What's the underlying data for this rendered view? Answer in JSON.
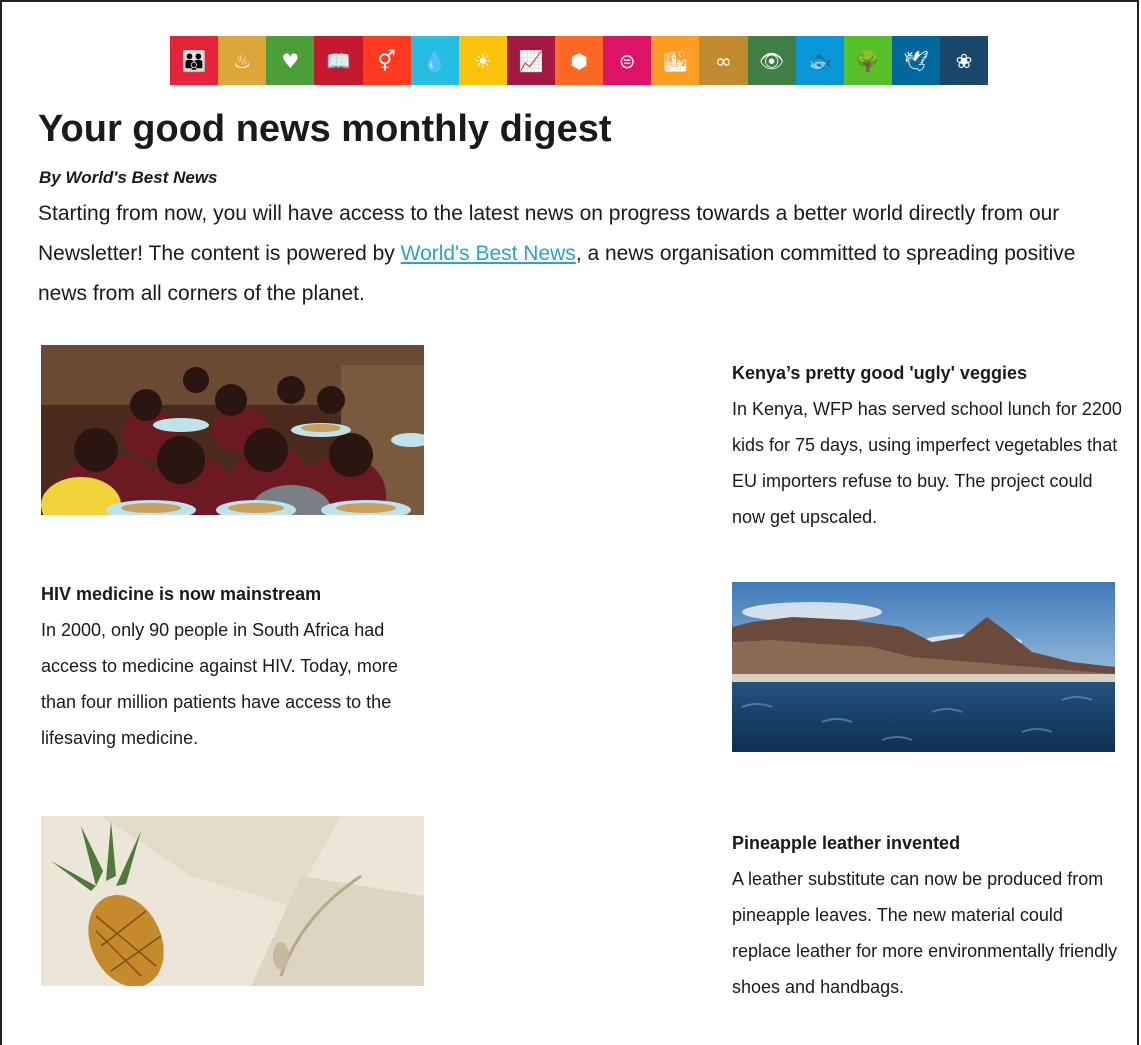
{
  "sdg_icons": [
    {
      "icon": "people-icon",
      "glyph": "👪",
      "color": "#e5243b"
    },
    {
      "icon": "bowl-icon",
      "glyph": "♨",
      "color": "#dda63a"
    },
    {
      "icon": "heartbeat-icon",
      "glyph": "♥",
      "color": "#4c9f38"
    },
    {
      "icon": "book-icon",
      "glyph": "📖",
      "color": "#c5192d"
    },
    {
      "icon": "gender-icon",
      "glyph": "⚥",
      "color": "#ff3a21"
    },
    {
      "icon": "water-drop-icon",
      "glyph": "💧",
      "color": "#26bde2"
    },
    {
      "icon": "sun-icon",
      "glyph": "☀",
      "color": "#fcc30b"
    },
    {
      "icon": "growth-chart-icon",
      "glyph": "📈",
      "color": "#a21942"
    },
    {
      "icon": "cubes-icon",
      "glyph": "⬢",
      "color": "#fd6925"
    },
    {
      "icon": "equality-icon",
      "glyph": "⊜",
      "color": "#dd1367"
    },
    {
      "icon": "city-icon",
      "glyph": "🏙",
      "color": "#fd9d24"
    },
    {
      "icon": "infinity-icon",
      "glyph": "∞",
      "color": "#bf8b2e"
    },
    {
      "icon": "eye-globe-icon",
      "glyph": "👁",
      "color": "#3f7e44"
    },
    {
      "icon": "fish-waves-icon",
      "glyph": "🐟",
      "color": "#0a97d9"
    },
    {
      "icon": "tree-icon",
      "glyph": "🌳",
      "color": "#56c02b"
    },
    {
      "icon": "dove-gavel-icon",
      "glyph": "🕊",
      "color": "#00689d"
    },
    {
      "icon": "flower-icon",
      "glyph": "❀",
      "color": "#19486a"
    }
  ],
  "header": {
    "title": "Your good news monthly digest",
    "byline": "By World's Best News"
  },
  "intro": {
    "before_link": "Starting from now, you will have access to the latest news on progress towards a better world directly from our Newsletter! The content is powered by ",
    "link_text": "World's Best News",
    "after_link": ", a news organisation committed to spreading positive news from all corners of the planet."
  },
  "articles": [
    {
      "title": "Kenya’s pretty good 'ugly' veggies",
      "body": "In Kenya, WFP has served school lunch for 2200 kids for 75 days, using imperfect vegetables that EU importers refuse to buy. The project could now get upscaled."
    },
    {
      "title": "HIV medicine is now mainstream",
      "body": "In 2000, only 90 people in South Africa had access to medicine against HIV. Today, more than four million patients have access to the lifesaving medicine."
    },
    {
      "title": "Pineapple leather invented",
      "body": "A leather substitute can now be produced from pineapple leaves. The new material could replace leather for more environmentally friendly shoes and handbags."
    }
  ]
}
